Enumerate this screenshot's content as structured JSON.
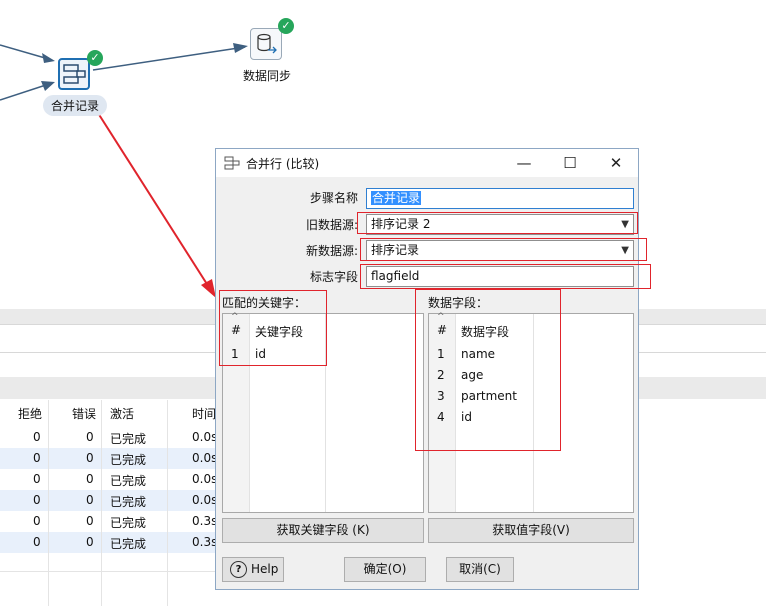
{
  "canvas": {
    "merge_step_label": "合并记录",
    "sync_step_label": "数据同步"
  },
  "grid": {
    "columns": [
      "拒绝",
      "错误",
      "激活",
      "时间"
    ],
    "rows": [
      {
        "reject": "0",
        "error": "0",
        "status": "已完成",
        "time": "0.0s"
      },
      {
        "reject": "0",
        "error": "0",
        "status": "已完成",
        "time": "0.0s"
      },
      {
        "reject": "0",
        "error": "0",
        "status": "已完成",
        "time": "0.0s"
      },
      {
        "reject": "0",
        "error": "0",
        "status": "已完成",
        "time": "0.0s"
      },
      {
        "reject": "0",
        "error": "0",
        "status": "已完成",
        "time": "0.3s"
      },
      {
        "reject": "0",
        "error": "0",
        "status": "已完成",
        "time": "0.3s"
      }
    ]
  },
  "dialog": {
    "title": "合并行 (比较)",
    "step_name_label": "步骤名称",
    "step_name_value": "合并记录",
    "old_source_label": "旧数据源:",
    "old_source_value": "排序记录 2",
    "new_source_label": "新数据源:",
    "new_source_value": "排序记录",
    "flag_field_label": "标志字段",
    "flag_field_value": "flagfield",
    "keys_section": "匹配的关键字：",
    "values_section": "数据字段：",
    "keys_table": {
      "num_header": "#",
      "col_header": "关键字段",
      "rows": [
        {
          "num": "1",
          "value": "id"
        }
      ]
    },
    "values_table": {
      "num_header": "#",
      "col_header": "数据字段",
      "rows": [
        {
          "num": "1",
          "value": "name"
        },
        {
          "num": "2",
          "value": "age"
        },
        {
          "num": "3",
          "value": "partment"
        },
        {
          "num": "4",
          "value": "id"
        }
      ]
    },
    "get_keys_button": "获取关键字段 (K)",
    "get_values_button": "获取值字段(V)",
    "help_button": "Help",
    "ok_button": "确定(O)",
    "cancel_button": "取消(C)"
  },
  "colors": {
    "annotation_red": "#e0242c",
    "status_ok": "#26a65b",
    "selection_blue": "#3390ff"
  }
}
